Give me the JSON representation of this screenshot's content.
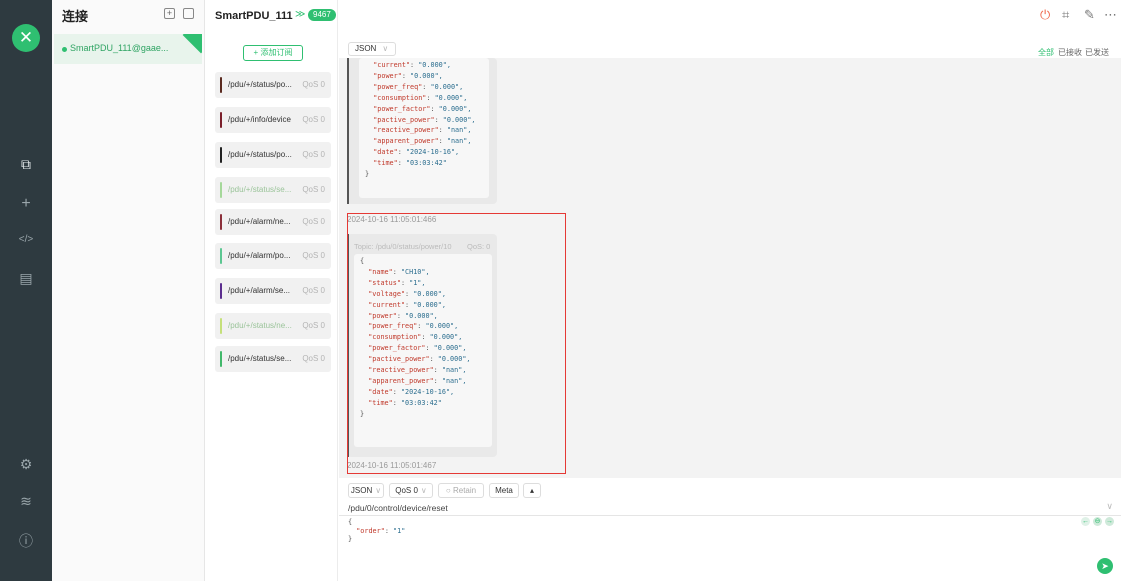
{
  "sidebar": {
    "logo_text": "✕",
    "icons": [
      "connections-icon",
      "add-icon",
      "script-icon",
      "log-icon",
      "settings-icon",
      "benchmark-icon",
      "about-icon"
    ]
  },
  "connections": {
    "title": "连接",
    "items": [
      {
        "name": "SmartPDU_111@gaae...",
        "status_color": "#2fbf71",
        "corner_tag": "SSL"
      }
    ]
  },
  "header": {
    "connection_name": "SmartPDU_111",
    "message_count": "9467",
    "filters": [
      "全部",
      "已接收",
      "已发送"
    ]
  },
  "subscriptions": {
    "add_label": "+ 添加订阅",
    "items": [
      {
        "topic": "/pdu/+/status/po...",
        "qos": "QoS 0",
        "color": "#5a2a1f",
        "dim": false
      },
      {
        "topic": "/pdu/+/info/device",
        "qos": "QoS 0",
        "color": "#7b1f2b",
        "dim": false
      },
      {
        "topic": "/pdu/+/status/po...",
        "qos": "QoS 0",
        "color": "#222222",
        "dim": false
      },
      {
        "topic": "/pdu/+/status/se...",
        "qos": "QoS 0",
        "color": "#a5d89a",
        "dim": true
      },
      {
        "topic": "/pdu/+/alarm/ne...",
        "qos": "QoS 0",
        "color": "#8b2f3a",
        "dim": false
      },
      {
        "topic": "/pdu/+/alarm/po...",
        "qos": "QoS 0",
        "color": "#5cc792",
        "dim": false
      },
      {
        "topic": "/pdu/+/alarm/se...",
        "qos": "QoS 0",
        "color": "#5b2d8e",
        "dim": false
      },
      {
        "topic": "/pdu/+/status/ne...",
        "qos": "QoS 0",
        "color": "#c5e07a",
        "dim": true
      },
      {
        "topic": "/pdu/+/status/se...",
        "qos": "QoS 0",
        "color": "#41b86b",
        "dim": false
      }
    ]
  },
  "messages": {
    "format": "JSON",
    "first": {
      "lines": [
        {
          "k": "\"current\"",
          "v": "\"0.000\","
        },
        {
          "k": "\"power\"",
          "v": "\"0.000\","
        },
        {
          "k": "\"power_freq\"",
          "v": "\"0.000\","
        },
        {
          "k": "\"consumption\"",
          "v": "\"0.000\","
        },
        {
          "k": "\"power_factor\"",
          "v": "\"0.000\","
        },
        {
          "k": "\"pactive_power\"",
          "v": "\"0.000\","
        },
        {
          "k": "\"reactive_power\"",
          "v": "\"nan\","
        },
        {
          "k": "\"apparent_power\"",
          "v": "\"nan\","
        },
        {
          "k": "\"date\"",
          "v": "\"2024-10-16\","
        },
        {
          "k": "\"time\"",
          "v": "\"03:03:42\""
        }
      ],
      "timestamp": "2024-10-16 11:05:01:466"
    },
    "second": {
      "topic": "Topic: /pdu/0/status/power/10",
      "qos": "QoS: 0",
      "lines": [
        {
          "k": "\"name\"",
          "v": "\"CH10\","
        },
        {
          "k": "\"status\"",
          "v": "\"1\","
        },
        {
          "k": "\"voltage\"",
          "v": "\"0.000\","
        },
        {
          "k": "\"current\"",
          "v": "\"0.000\","
        },
        {
          "k": "\"power\"",
          "v": "\"0.000\","
        },
        {
          "k": "\"power_freq\"",
          "v": "\"0.000\","
        },
        {
          "k": "\"consumption\"",
          "v": "\"0.000\","
        },
        {
          "k": "\"power_factor\"",
          "v": "\"0.000\","
        },
        {
          "k": "\"pactive_power\"",
          "v": "\"0.000\","
        },
        {
          "k": "\"reactive_power\"",
          "v": "\"nan\","
        },
        {
          "k": "\"apparent_power\"",
          "v": "\"nan\","
        },
        {
          "k": "\"date\"",
          "v": "\"2024-10-16\","
        },
        {
          "k": "\"time\"",
          "v": "\"03:03:42\""
        }
      ],
      "timestamp": "2024-10-16 11:05:01:467"
    }
  },
  "publish": {
    "format": "JSON",
    "qos": "QoS 0",
    "retain_label": "Retain",
    "meta_label": "Meta",
    "topic": "/pdu/0/control/device/reset",
    "payload_key": "\"order\"",
    "payload_value": "\"1\""
  },
  "colors": {
    "accent": "#2fbf71",
    "rail": "#2e3a40",
    "highlight": "#e53935"
  }
}
